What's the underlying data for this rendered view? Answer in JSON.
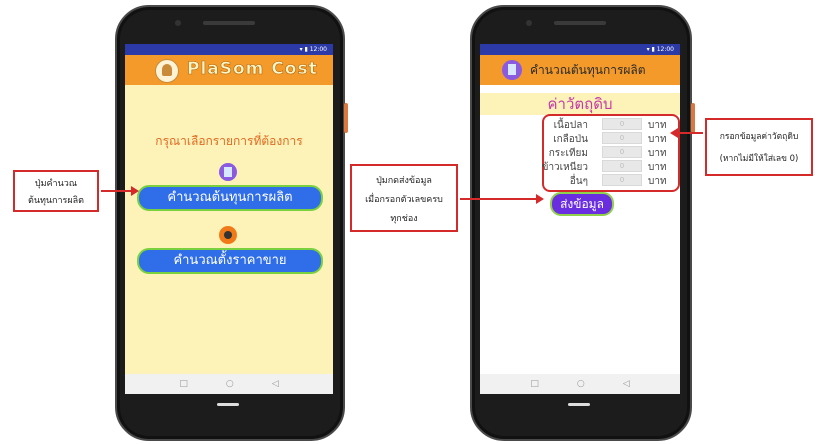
{
  "phone1": {
    "status_time": "▾ ▮ 12:00",
    "app_title": "PlaSom Cost",
    "prompt": "กรุณาเลือกรายการที่ต้องการ",
    "btn_production": "คำนวณต้นทุนการผลิต",
    "btn_price": "คำนวณตั้งราคาขาย",
    "nav": [
      "□",
      "○",
      "◁"
    ]
  },
  "phone2": {
    "status_time": "▾ ▮ 12:00",
    "app_title": "คำนวณต้นทุนการผลิต",
    "section_title": "ค่าวัตถุดิบ",
    "rows": [
      {
        "label": "เนื้อปลา",
        "value": "0",
        "unit": "บาท"
      },
      {
        "label": "เกลือป่น",
        "value": "0",
        "unit": "บาท"
      },
      {
        "label": "กระเทียม",
        "value": "0",
        "unit": "บาท"
      },
      {
        "label": "ข้าวเหนียว",
        "value": "0",
        "unit": "บาท"
      },
      {
        "label": "อื่นๆ",
        "value": "0",
        "unit": "บาท"
      }
    ],
    "submit": "ส่งข้อมูล",
    "nav": [
      "□",
      "○",
      "◁"
    ]
  },
  "callouts": {
    "left": [
      "ปุ่มคำนวณ",
      "ต้นทุนการผลิต"
    ],
    "middle": [
      "ปุ่มกดส่งข้อมูล",
      "เมื่อกรอกตัวเลขครบ",
      "ทุกช่อง"
    ],
    "right": [
      "กรอกข้อมูลค่าวัตถุดิบ",
      "(หากไม่มีให้ใส่เลข 0)"
    ]
  },
  "colors": {
    "appbar": "#f39a2a",
    "screen_bg": "#fdf2b8",
    "button_blue": "#2f6ee8",
    "button_border": "#7ad13f",
    "callout_red": "#d42a2a",
    "submit_purple": "#6a2de0"
  }
}
